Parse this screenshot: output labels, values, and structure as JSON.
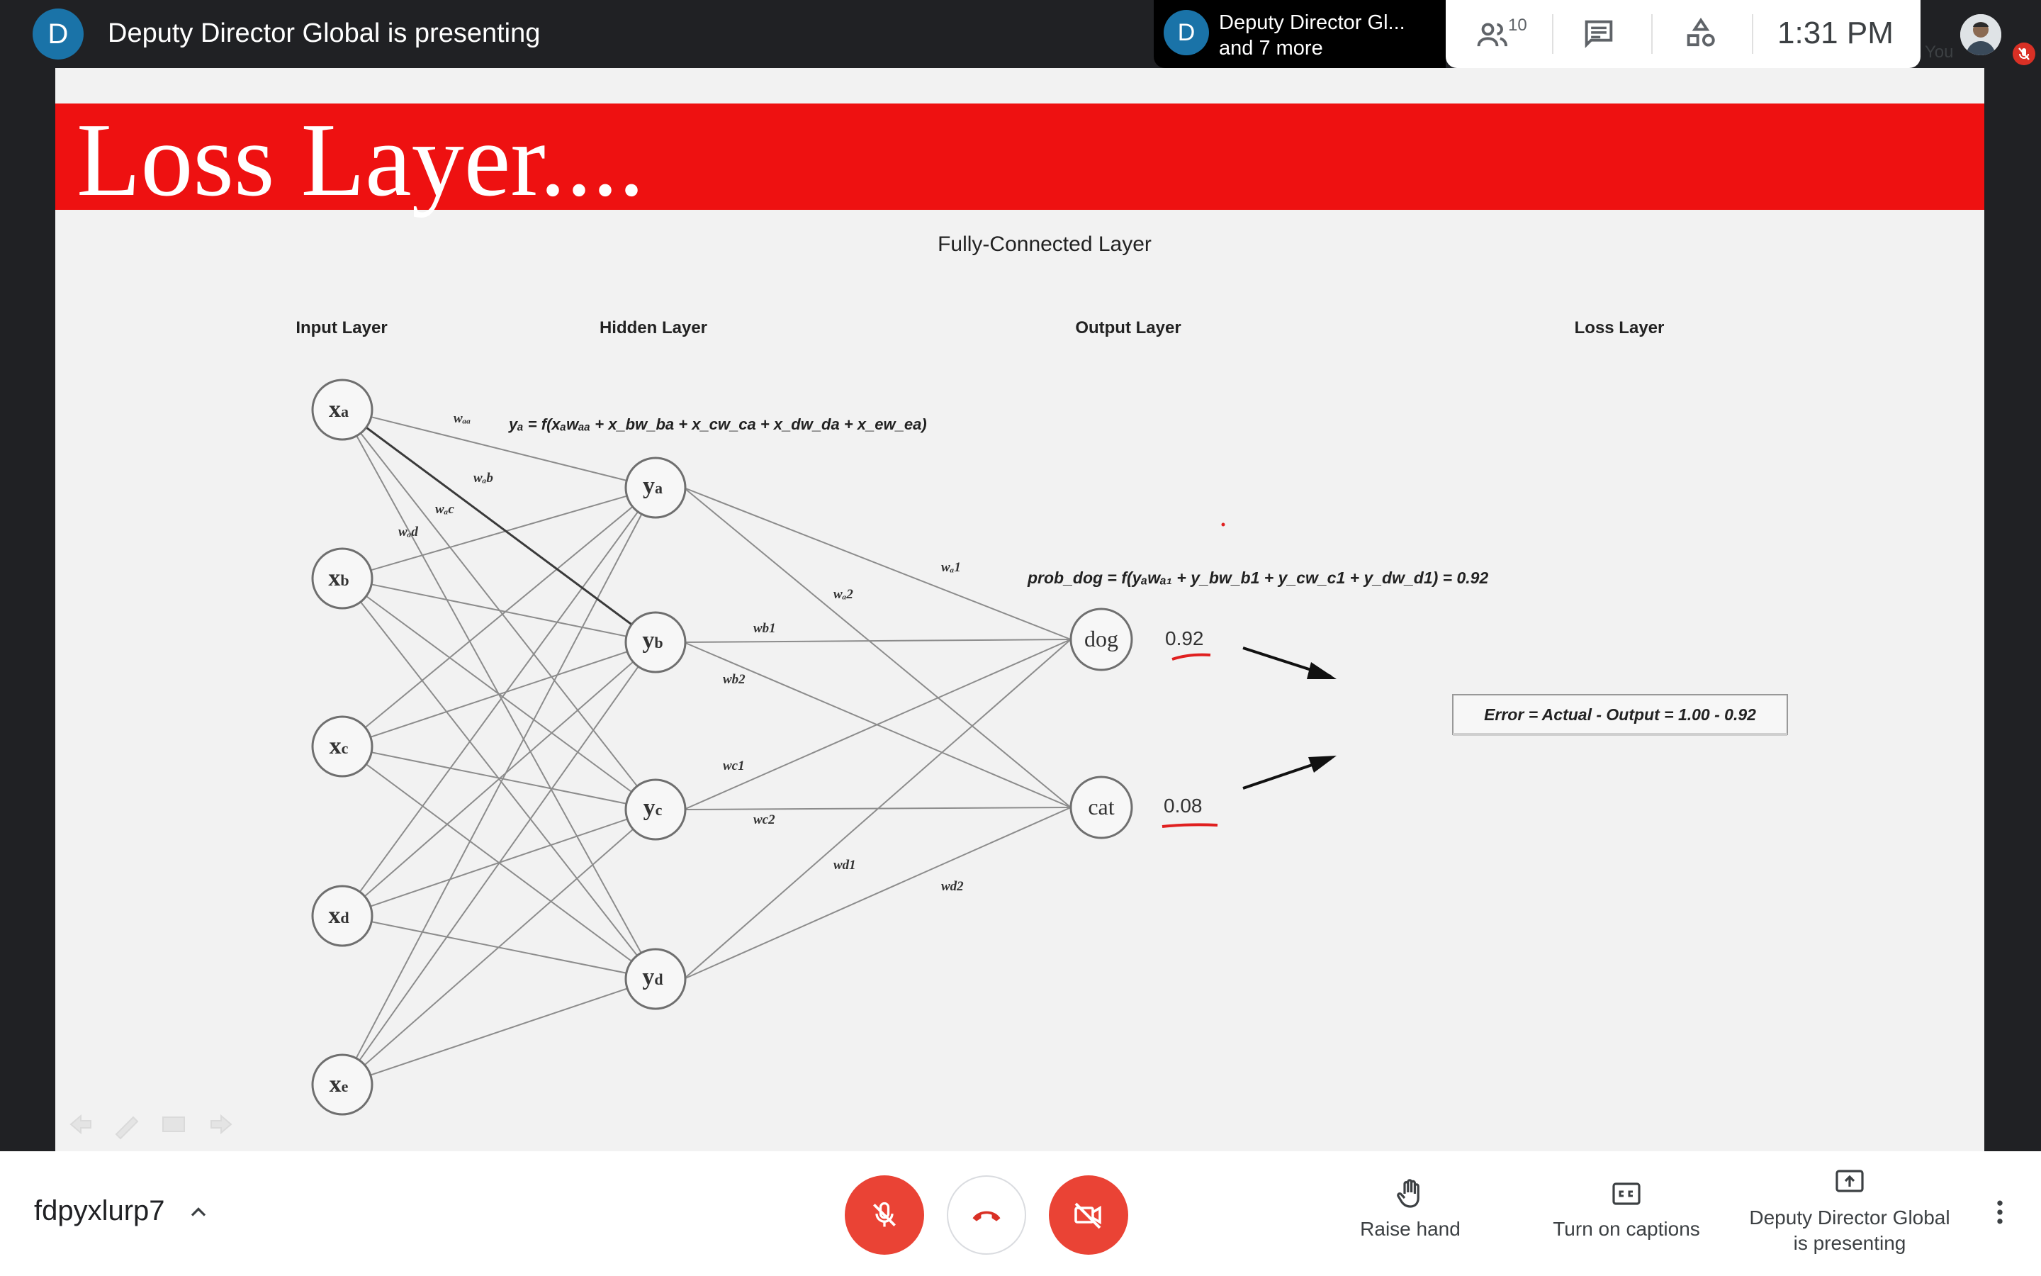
{
  "top_bar": {
    "presenter_initial": "D",
    "presenting_title": "Deputy Director Global is presenting",
    "tile_initial": "D",
    "tile_name": "Deputy Director Gl...",
    "tile_more": "and 7 more",
    "participants_count": "10",
    "time": "1:31 PM",
    "self_label": "You"
  },
  "slide": {
    "title": "Loss Layer....",
    "heading": "Fully-Connected Layer",
    "layer_labels": {
      "input": "Input Layer",
      "hidden": "Hidden Layer",
      "output": "Output Layer",
      "loss": "Loss Layer"
    },
    "input_nodes": [
      "x",
      "x",
      "x",
      "x",
      "x"
    ],
    "input_subs": [
      "a",
      "b",
      "c",
      "d",
      "e"
    ],
    "hidden_nodes": [
      "y",
      "y",
      "y",
      "y"
    ],
    "hidden_subs": [
      "a",
      "b",
      "c",
      "d"
    ],
    "output_nodes": [
      "dog",
      "cat"
    ],
    "output_values": [
      "0.92",
      "0.08"
    ],
    "formula_ya": "yₐ = f(xₐwₐₐ + x_bw_ba + x_cw_ca + x_dw_da + x_ew_ea)",
    "formula_prob": "prob_dog = f(yₐwₐ₁ + y_bw_b1 + y_cw_c1 + y_dw_d1) = 0.92",
    "error_text": "Error = Actual - Output = 1.00 - 0.92",
    "weight_labels": {
      "waa": "wₐₐ",
      "wab": "wₐb",
      "wac": "wₐc",
      "wad": "wₐd",
      "wa1": "wₐ1",
      "wa2": "wₐ2",
      "wb1": "wb1",
      "wb2": "wb2",
      "wc1": "wc1",
      "wc2": "wc2",
      "wd1": "wd1",
      "wd2": "wd2"
    }
  },
  "bottom_bar": {
    "meeting_code": "fdpyxlurp7",
    "raise_hand": "Raise hand",
    "captions": "Turn on captions",
    "presenting_line1": "Deputy Director Global",
    "presenting_line2": "is presenting"
  },
  "colors": {
    "banner_red": "#ee1111",
    "call_red": "#ea4335",
    "presenter_blue": "#1a73a8"
  }
}
